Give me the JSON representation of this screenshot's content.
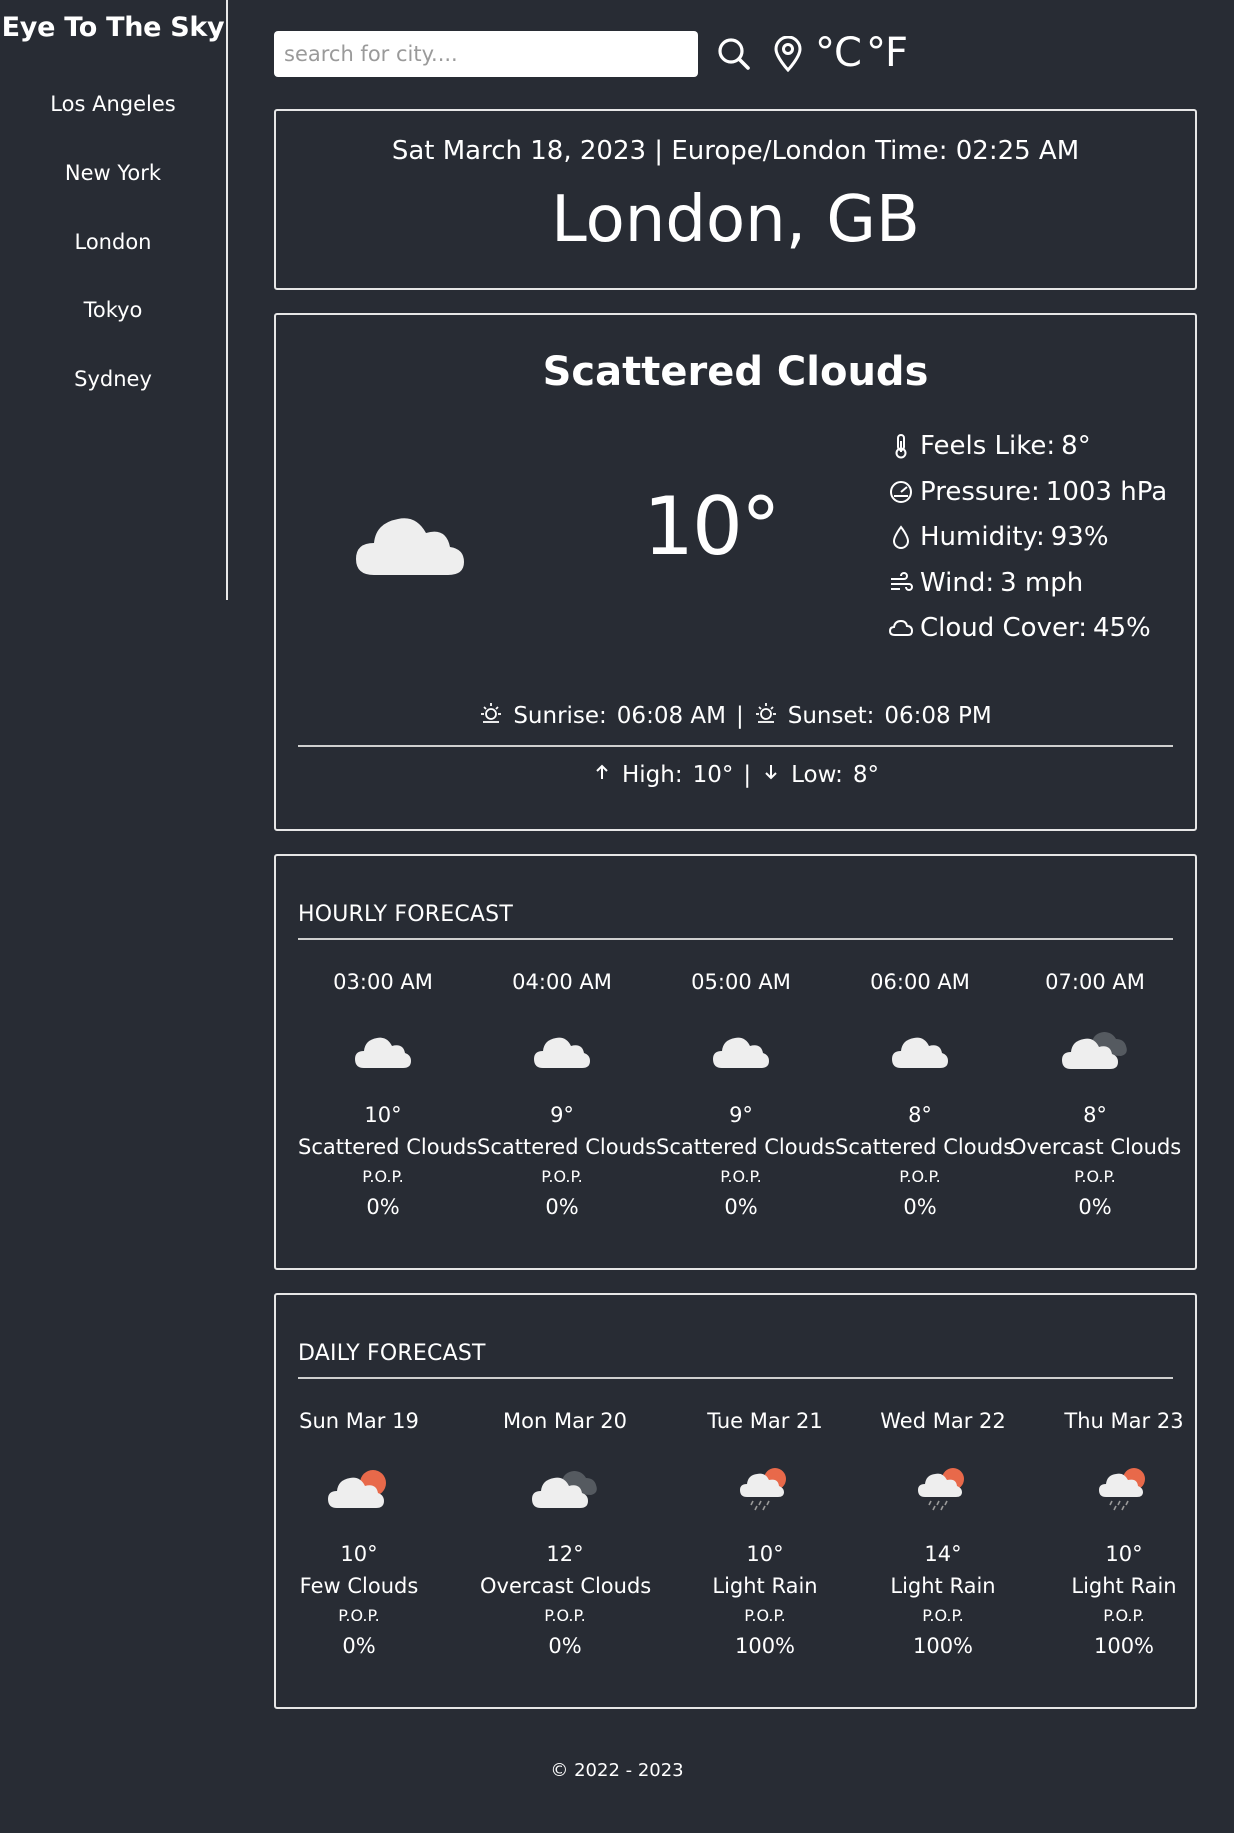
{
  "brand": "Eye To The Sky",
  "sidebar": {
    "cities": [
      "Los Angeles",
      "New York",
      "London",
      "Tokyo",
      "Sydney"
    ]
  },
  "search": {
    "placeholder": "search for city....",
    "icon": "search-icon",
    "location_icon": "map-pin-icon"
  },
  "units": {
    "celsius": "°C",
    "fahrenheit": "°F"
  },
  "header": {
    "datetime": "Sat March 18, 2023 | Europe/London Time: 02:25 AM",
    "location": "London, GB"
  },
  "current": {
    "condition": "Scattered Clouds",
    "temp": "10°",
    "stats": [
      {
        "icon": "thermometer-icon",
        "label": "Feels Like:",
        "value": "8°"
      },
      {
        "icon": "pressure-icon",
        "label": "Pressure:",
        "value": "1003 hPa"
      },
      {
        "icon": "droplet-icon",
        "label": "Humidity:",
        "value": "93%"
      },
      {
        "icon": "wind-icon",
        "label": "Wind:",
        "value": "3 mph"
      },
      {
        "icon": "cloud-outline-icon",
        "label": "Cloud Cover:",
        "value": "45%"
      }
    ],
    "sunrise_label": "Sunrise:",
    "sunrise": "06:08 AM",
    "sunset_label": "Sunset:",
    "sunset": "06:08 PM",
    "sep": "|",
    "high_label": "High:",
    "high": "10°",
    "low_label": "Low:",
    "low": "8°"
  },
  "hourly": {
    "title": "HOURLY FORECAST",
    "pop_label": "P.O.P.",
    "items": [
      {
        "time": "03:00 AM",
        "temp": "10°",
        "desc": "Scattered Clouds",
        "pop": "0%"
      },
      {
        "time": "04:00 AM",
        "temp": "9°",
        "desc": "Scattered Clouds",
        "pop": "0%"
      },
      {
        "time": "05:00 AM",
        "temp": "9°",
        "desc": "Scattered Clouds",
        "pop": "0%"
      },
      {
        "time": "06:00 AM",
        "temp": "8°",
        "desc": "Scattered Clouds",
        "pop": "0%"
      },
      {
        "time": "07:00 AM",
        "temp": "8°",
        "desc": "Overcast Clouds",
        "pop": "0%"
      }
    ]
  },
  "daily": {
    "title": "DAILY FORECAST",
    "pop_label": "P.O.P.",
    "items": [
      {
        "day": "Sun Mar 19",
        "temp": "10°",
        "desc": "Few Clouds",
        "pop": "0%"
      },
      {
        "day": "Mon Mar 20",
        "temp": "12°",
        "desc": "Overcast Clouds",
        "pop": "0%"
      },
      {
        "day": "Tue Mar 21",
        "temp": "10°",
        "desc": "Light Rain",
        "pop": "100%"
      },
      {
        "day": "Wed Mar 22",
        "temp": "14°",
        "desc": "Light Rain",
        "pop": "100%"
      },
      {
        "day": "Thu Mar 23",
        "temp": "10°",
        "desc": "Light Rain",
        "pop": "100%"
      }
    ]
  },
  "footer": "© 2022 - 2023",
  "colors": {
    "background": "#282c34",
    "text": "#ffffff",
    "border": "#e6e6e6",
    "sun": "#e8694a"
  }
}
